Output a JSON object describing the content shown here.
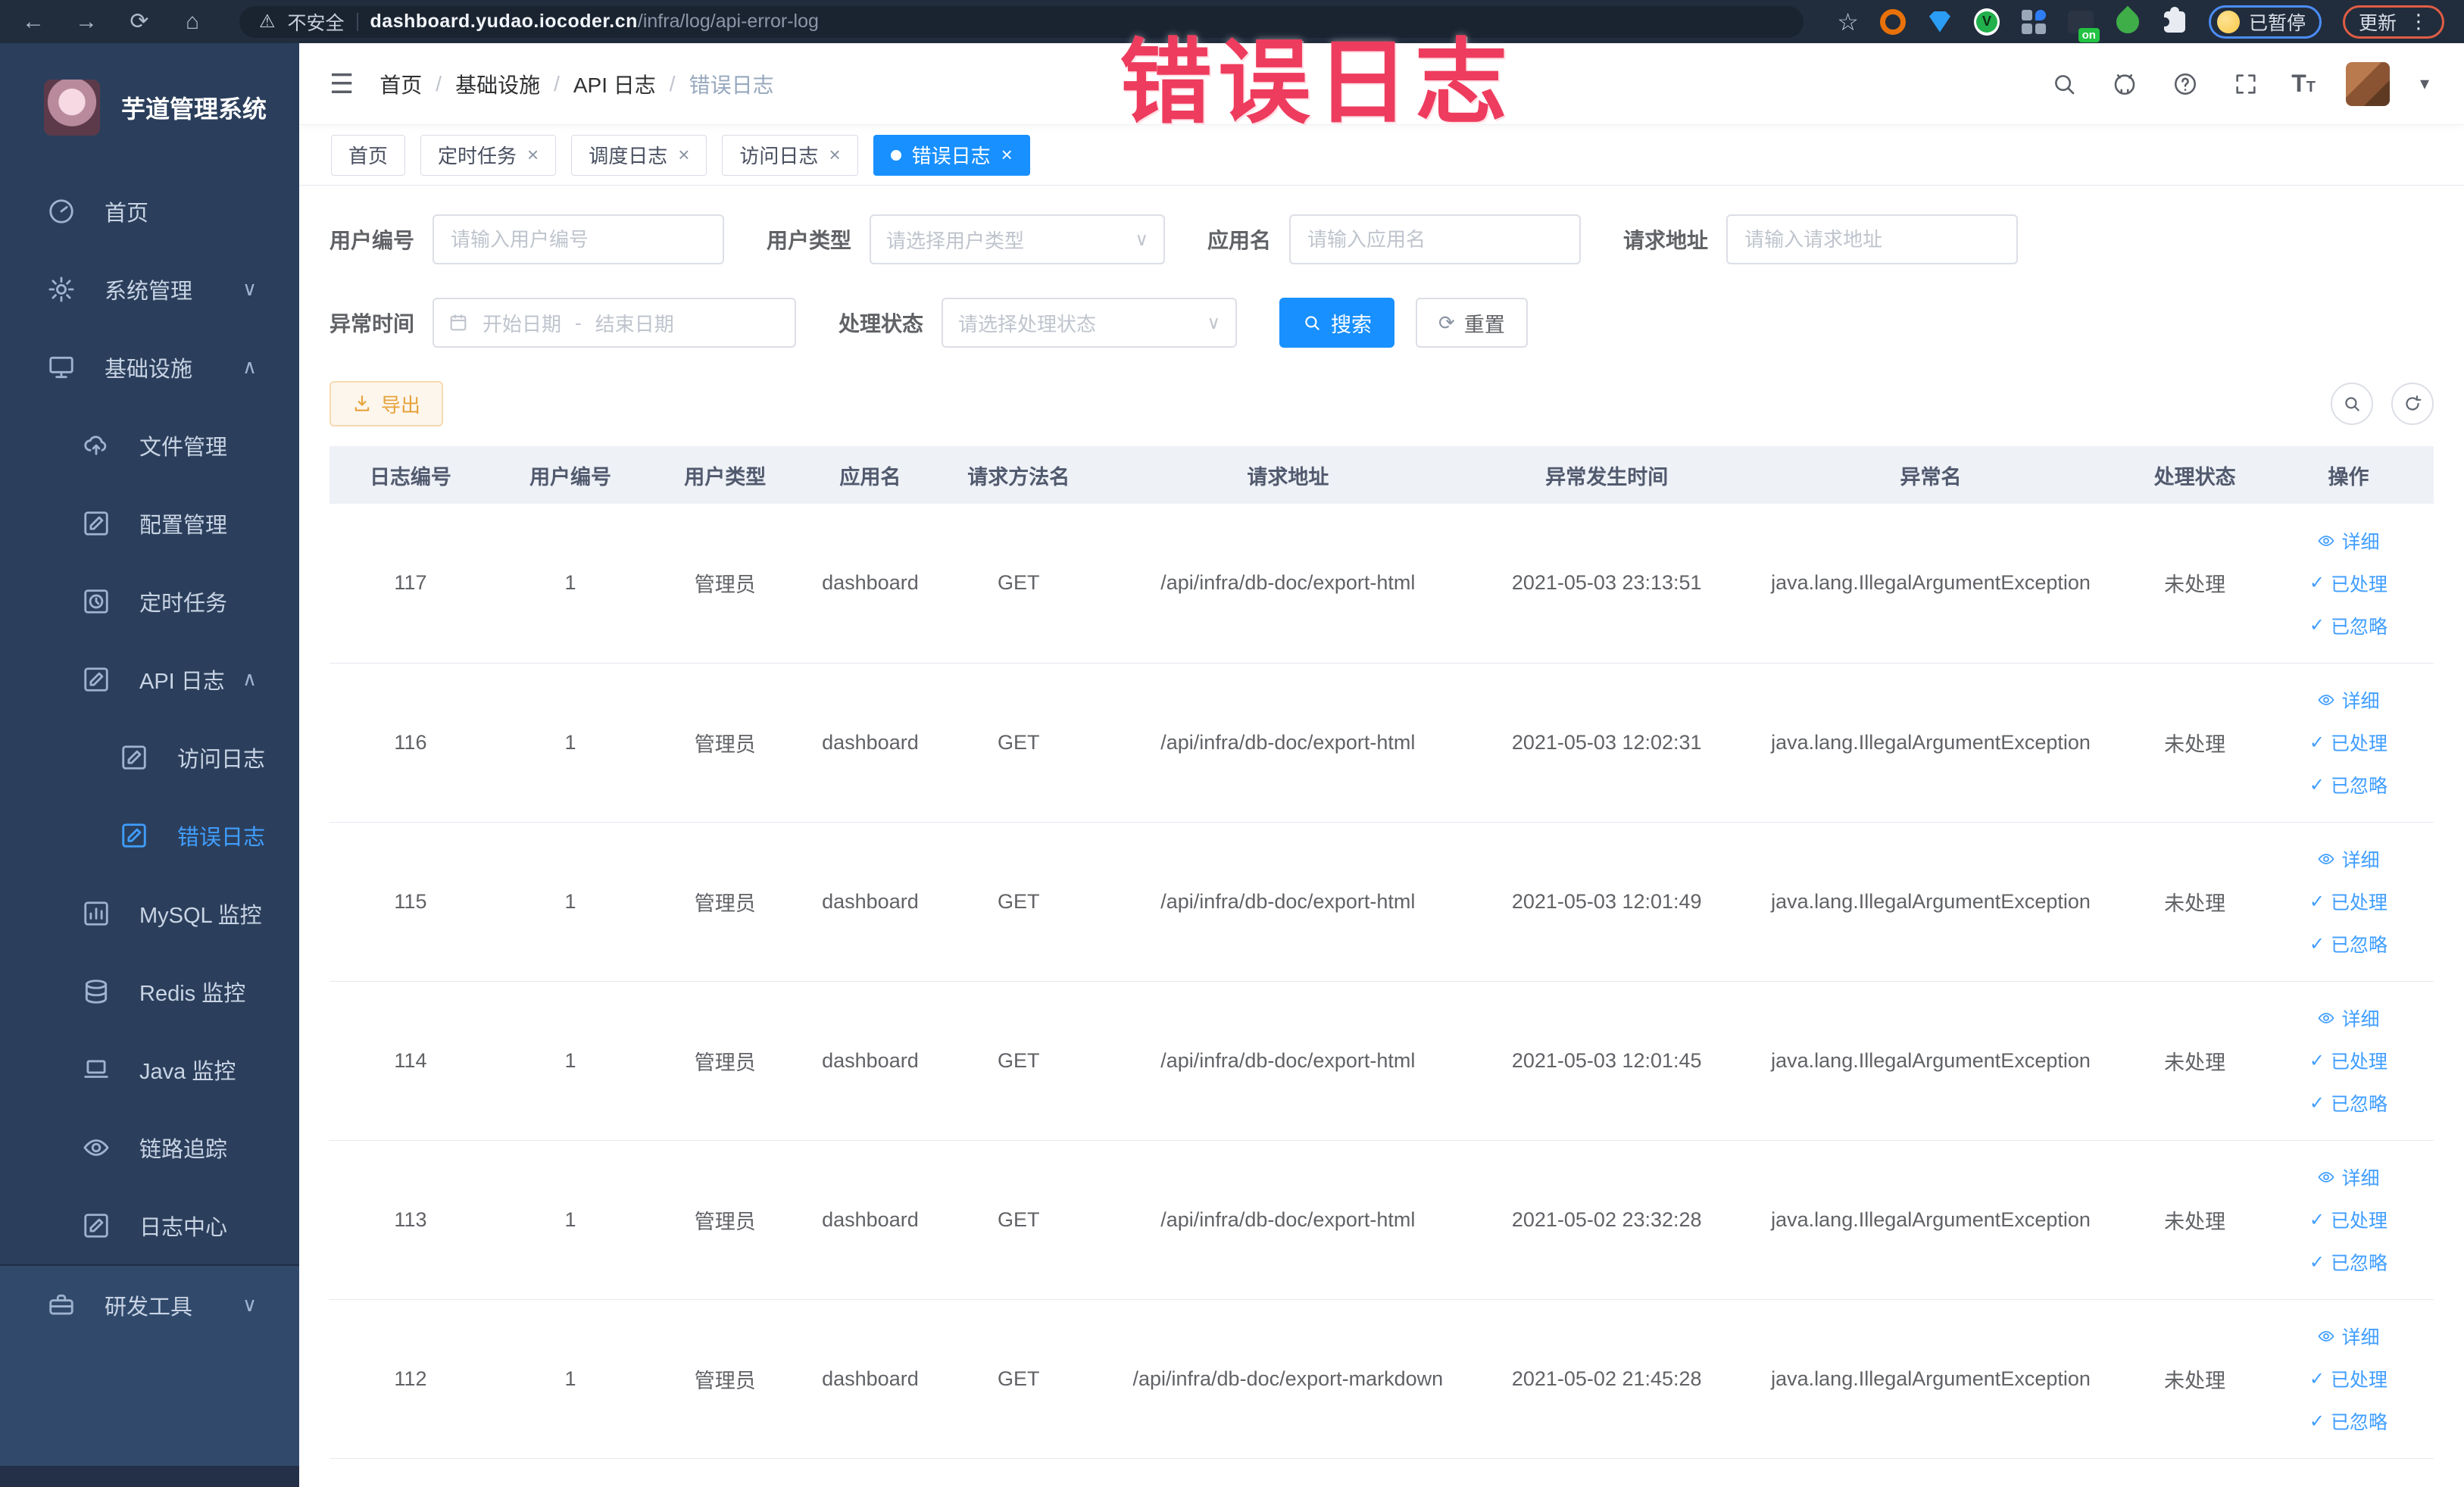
{
  "browser": {
    "security_label": "不安全",
    "url_host": "dashboard.yudao.iocoder.cn",
    "url_path": "/infra/log/api-error-log",
    "paused_label": "已暂停",
    "update_label": "更新",
    "ext_badge": "on",
    "greenv_letter": "V"
  },
  "annotation": {
    "text": "错误日志",
    "color": "#ee3c5e"
  },
  "colors": {
    "accent": "#1890ff",
    "link": "#409eff",
    "export_text": "#e6a23c",
    "sidebar_bg": "#2b3f5c"
  },
  "icons": {
    "back": "←",
    "forward": "→",
    "reload": "⟳",
    "home": "⌂",
    "warning": "⚠",
    "star": "☆",
    "kebab": "⋮",
    "hamburger": "☰",
    "caret_down": "▾",
    "chevron_down": "∨",
    "chevron_up": "∧",
    "check": "✓",
    "close": "×",
    "refresh": "⟳",
    "font_size_big": "T",
    "font_size_small": "T"
  },
  "sidebar": {
    "title": "芋道管理系统",
    "menu": [
      {
        "label": "首页"
      },
      {
        "label": "系统管理"
      },
      {
        "label": "基础设施"
      },
      {
        "label": "文件管理"
      },
      {
        "label": "配置管理"
      },
      {
        "label": "定时任务"
      },
      {
        "label": "API 日志"
      },
      {
        "label": "访问日志"
      },
      {
        "label": "错误日志"
      },
      {
        "label": "MySQL 监控"
      },
      {
        "label": "Redis 监控"
      },
      {
        "label": "Java 监控"
      },
      {
        "label": "链路追踪"
      },
      {
        "label": "日志中心"
      },
      {
        "label": "研发工具"
      }
    ]
  },
  "breadcrumb": {
    "items": [
      "首页",
      "基础设施",
      "API 日志",
      "错误日志"
    ],
    "separator": "/"
  },
  "tabs": [
    {
      "label": "首页",
      "closable": false,
      "active": false
    },
    {
      "label": "定时任务",
      "closable": true,
      "active": false
    },
    {
      "label": "调度日志",
      "closable": true,
      "active": false
    },
    {
      "label": "访问日志",
      "closable": true,
      "active": false
    },
    {
      "label": "错误日志",
      "closable": true,
      "active": true
    }
  ],
  "filters": {
    "user_id": {
      "label": "用户编号",
      "placeholder": "请输入用户编号"
    },
    "user_type": {
      "label": "用户类型",
      "placeholder": "请选择用户类型"
    },
    "app_name": {
      "label": "应用名",
      "placeholder": "请输入应用名"
    },
    "request_url": {
      "label": "请求地址",
      "placeholder": "请输入请求地址"
    },
    "exception_time": {
      "label": "异常时间",
      "start_placeholder": "开始日期",
      "separator": "-",
      "end_placeholder": "结束日期"
    },
    "process_status": {
      "label": "处理状态",
      "placeholder": "请选择处理状态"
    },
    "search_label": "搜索",
    "reset_label": "重置"
  },
  "toolbar": {
    "export_label": "导出"
  },
  "table": {
    "columns": [
      "日志编号",
      "用户编号",
      "用户类型",
      "应用名",
      "请求方法名",
      "请求地址",
      "异常发生时间",
      "异常名",
      "处理状态",
      "操作"
    ],
    "actions": [
      "详细",
      "已处理",
      "已忽略"
    ],
    "rows": [
      {
        "id": "117",
        "user_id": "1",
        "user_type": "管理员",
        "app": "dashboard",
        "method": "GET",
        "url": "/api/infra/db-doc/export-html",
        "time": "2021-05-03 23:13:51",
        "exception": "java.lang.IllegalArgumentException",
        "status": "未处理"
      },
      {
        "id": "116",
        "user_id": "1",
        "user_type": "管理员",
        "app": "dashboard",
        "method": "GET",
        "url": "/api/infra/db-doc/export-html",
        "time": "2021-05-03 12:02:31",
        "exception": "java.lang.IllegalArgumentException",
        "status": "未处理"
      },
      {
        "id": "115",
        "user_id": "1",
        "user_type": "管理员",
        "app": "dashboard",
        "method": "GET",
        "url": "/api/infra/db-doc/export-html",
        "time": "2021-05-03 12:01:49",
        "exception": "java.lang.IllegalArgumentException",
        "status": "未处理"
      },
      {
        "id": "114",
        "user_id": "1",
        "user_type": "管理员",
        "app": "dashboard",
        "method": "GET",
        "url": "/api/infra/db-doc/export-html",
        "time": "2021-05-03 12:01:45",
        "exception": "java.lang.IllegalArgumentException",
        "status": "未处理"
      },
      {
        "id": "113",
        "user_id": "1",
        "user_type": "管理员",
        "app": "dashboard",
        "method": "GET",
        "url": "/api/infra/db-doc/export-html",
        "time": "2021-05-02 23:32:28",
        "exception": "java.lang.IllegalArgumentException",
        "status": "未处理"
      },
      {
        "id": "112",
        "user_id": "1",
        "user_type": "管理员",
        "app": "dashboard",
        "method": "GET",
        "url": "/api/infra/db-doc/export-markdown",
        "time": "2021-05-02 21:45:28",
        "exception": "java.lang.IllegalArgumentException",
        "status": "未处理"
      }
    ]
  }
}
